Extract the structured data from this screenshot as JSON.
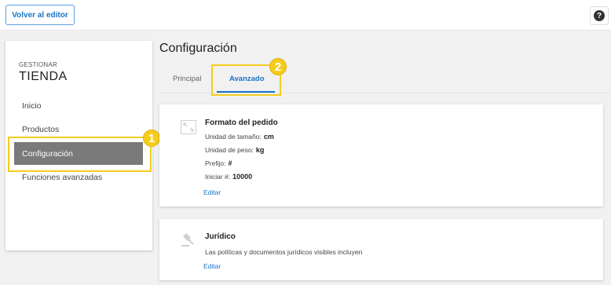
{
  "topbar": {
    "back_label": "Volver al editor",
    "help_glyph": "?"
  },
  "sidebar": {
    "subtitle": "GESTIONAR",
    "title": "TIENDA",
    "items": [
      {
        "label": "Inicio"
      },
      {
        "label": "Productos"
      },
      {
        "label": "Configuración"
      },
      {
        "label": "Funciones avanzadas"
      }
    ]
  },
  "main": {
    "title": "Configuración",
    "tabs": [
      {
        "label": "Principal"
      },
      {
        "label": "Avanzado"
      }
    ]
  },
  "cards": {
    "order": {
      "title": "Formato del pedido",
      "rows": [
        {
          "label": "Unidad de tamaño:",
          "value": "cm"
        },
        {
          "label": "Unidad de peso:",
          "value": "kg"
        },
        {
          "label": "Prefijo:",
          "value": "#"
        },
        {
          "label": "Iniciar #:",
          "value": "10000"
        }
      ],
      "edit_label": "Editar",
      "icon": "expand-icon"
    },
    "legal": {
      "title": "Jurídico",
      "description": "Las políticas y documentos jurídicos visibles incluyen",
      "edit_label": "Editar",
      "icon": "gavel-icon"
    }
  },
  "annotations": {
    "badge1": "1",
    "badge2": "2"
  },
  "colors": {
    "accent": "#1a73c8",
    "highlight": "#f5cc1e",
    "active_nav": "#7a7a7a"
  }
}
